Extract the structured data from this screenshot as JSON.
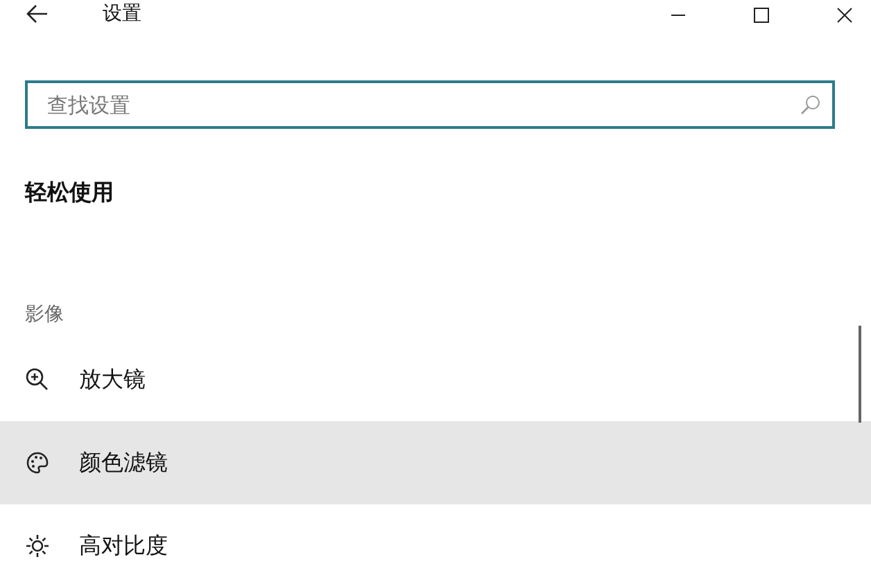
{
  "window": {
    "title": "设置"
  },
  "search": {
    "placeholder": "查找设置"
  },
  "heading": "轻松使用",
  "section": {
    "title": "影像",
    "items": [
      {
        "kind": "magnifier",
        "label": "放大镜",
        "selected": false
      },
      {
        "kind": "palette",
        "label": "颜色滤镜",
        "selected": true
      },
      {
        "kind": "sun",
        "label": "高对比度",
        "selected": false
      }
    ]
  }
}
